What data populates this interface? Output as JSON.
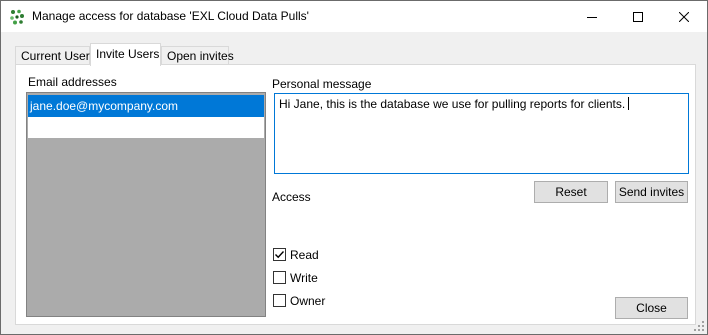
{
  "window": {
    "title": "Manage access for database 'EXL Cloud Data Pulls'"
  },
  "tabs": [
    {
      "label": "Current Users",
      "selected": false
    },
    {
      "label": "Invite Users",
      "selected": true
    },
    {
      "label": "Open invites",
      "selected": false
    }
  ],
  "email": {
    "label": "Email addresses",
    "items": [
      "jane.doe@mycompany.com"
    ]
  },
  "message": {
    "label": "Personal message",
    "value": "Hi Jane, this is the database we use for pulling reports for clients."
  },
  "buttons": {
    "reset": "Reset",
    "send": "Send invites",
    "close": "Close"
  },
  "access": {
    "label": "Access",
    "options": [
      {
        "label": "Read",
        "checked": true
      },
      {
        "label": "Write",
        "checked": false
      },
      {
        "label": "Owner",
        "checked": false
      }
    ]
  },
  "colors": {
    "selection": "#0078d7",
    "list_background": "#ababab"
  }
}
